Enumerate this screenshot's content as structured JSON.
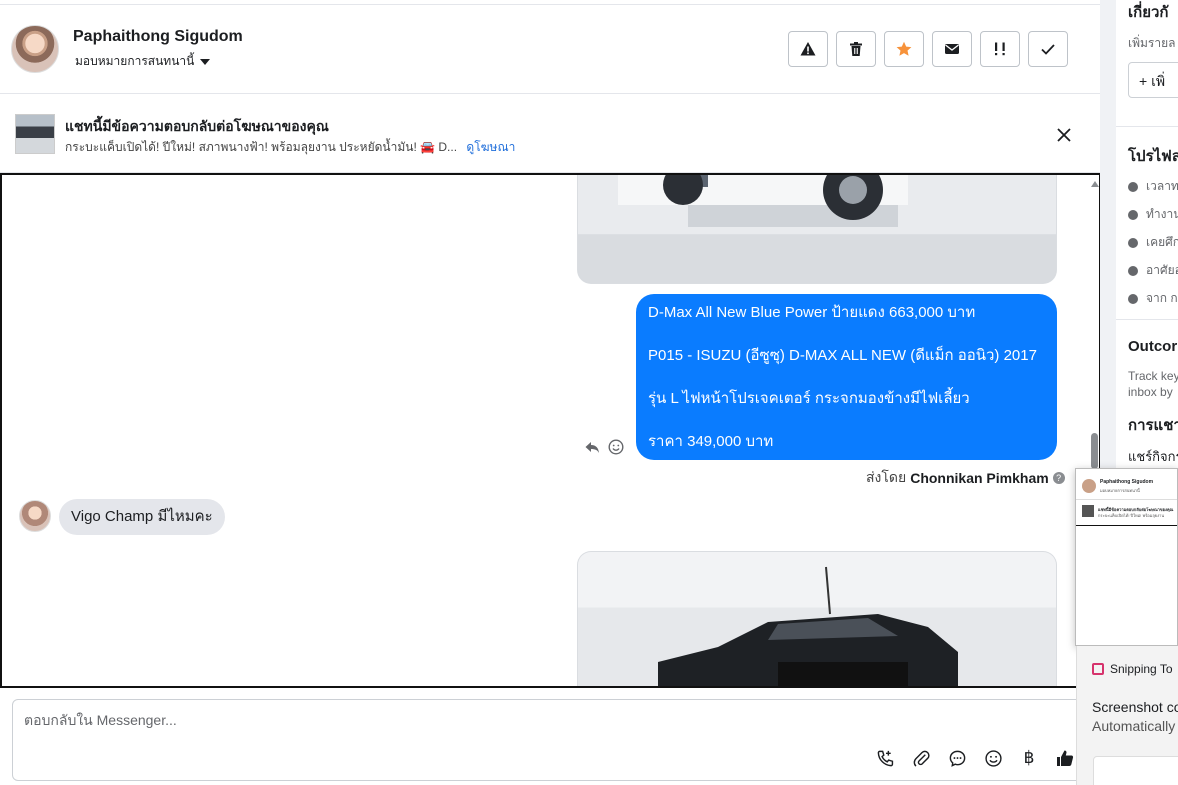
{
  "header": {
    "contact_name": "Paphaithong Sigudom",
    "assign_label": "มอบหมายการสนทนานี้",
    "actions": [
      {
        "name": "report-spam-button",
        "icon": "warning-icon"
      },
      {
        "name": "delete-button",
        "icon": "trash-icon"
      },
      {
        "name": "star-button",
        "icon": "star-icon"
      },
      {
        "name": "mark-unread-button",
        "icon": "envelope-icon"
      },
      {
        "name": "follow-up-button",
        "icon": "exclamation-icon"
      },
      {
        "name": "mark-done-button",
        "icon": "check-icon"
      }
    ],
    "star_color": "#f7923a"
  },
  "ad_banner": {
    "title": "แชทนี้มีข้อความตอบกลับต่อโฆษณาของคุณ",
    "subtitle": "กระบะแค็บเปิดได้! ปีใหม่! สภาพนางฟ้า! พร้อมลุยงาน ประหยัดน้ำมัน! 🚘 D...",
    "link": "ดูโฆษณา"
  },
  "thread": {
    "outgoing_lines": [
      "D-Max All New Blue Power ป้ายแดง 663,000 บาท",
      "P015 - ISUZU (อีซูซุ) D-MAX ALL NEW (ดีแม็ก ออนิว) 2017",
      " รุ่น L ไฟหน้าโปรเจคเตอร์ กระจกมองข้างมีไฟเลี้ยว",
      "ราคา 349,000 บาท"
    ],
    "sent_by_prefix": "ส่งโดย",
    "sent_by_name": "Chonnikan Pimkham",
    "incoming_text": "Vigo Champ มีไหมคะ",
    "bubble_color": "#0a7cff"
  },
  "composer": {
    "placeholder": "ตอบกลับใน Messenger...",
    "baht_symbol": "฿"
  },
  "sidebar": {
    "about_title": "เกี่ยวกั",
    "about_sub": "เพิ่มรายล",
    "add_label": "+ เพิ่",
    "profile_title": "โปรไฟล",
    "rows": [
      "เวลาท",
      "ทำงาน",
      "เคยศึก",
      "อาศัยอ",
      "จาก ก"
    ],
    "outcome_title": "Outcor",
    "outcome_t1": "Track key",
    "outcome_t2": "inbox by",
    "chat_title": "การแชา",
    "share_label": "แชร์กิจกร"
  },
  "snip": {
    "mini_name": "Paphaithong Sigudom",
    "mini_assign": "มอบหมายการสนทนานี้",
    "mini_ad_title": "แชทนี้มีข้อความตอบกลับต่อโฆษณาของคุณ",
    "mini_ad_sub": "กระบะแค็บเปิดได้! ปีใหม่! พร้อมลุยงาน",
    "app_name": "Snipping To",
    "title": "Screenshot co",
    "subtitle": "Automatically"
  }
}
